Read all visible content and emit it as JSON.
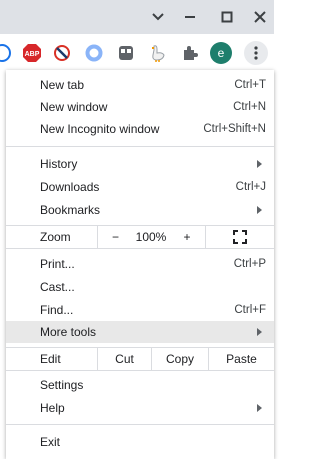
{
  "window": {
    "minimize_glyph": "−",
    "maximize_glyph": "□",
    "close_glyph": "✕"
  },
  "toolbar": {
    "abp_label": "ABP",
    "profile_initial": "e",
    "profile_color": "#1e7e6c"
  },
  "menu": {
    "new_tab": {
      "label": "New tab",
      "shortcut": "Ctrl+T"
    },
    "new_window": {
      "label": "New window",
      "shortcut": "Ctrl+N"
    },
    "new_incognito": {
      "label": "New Incognito window",
      "shortcut": "Ctrl+Shift+N"
    },
    "history": {
      "label": "History"
    },
    "downloads": {
      "label": "Downloads",
      "shortcut": "Ctrl+J"
    },
    "bookmarks": {
      "label": "Bookmarks"
    },
    "zoom": {
      "label": "Zoom",
      "minus": "−",
      "value": "100%",
      "plus": "+"
    },
    "print": {
      "label": "Print...",
      "shortcut": "Ctrl+P"
    },
    "cast": {
      "label": "Cast..."
    },
    "find": {
      "label": "Find...",
      "shortcut": "Ctrl+F"
    },
    "more_tools": {
      "label": "More tools"
    },
    "edit": {
      "label": "Edit",
      "cut": "Cut",
      "copy": "Copy",
      "paste": "Paste"
    },
    "settings": {
      "label": "Settings"
    },
    "help": {
      "label": "Help"
    },
    "exit": {
      "label": "Exit"
    }
  },
  "colors": {
    "titlebar": "#dee1e6",
    "highlight": "#e8e8e8",
    "abp_red": "#d7272a"
  }
}
